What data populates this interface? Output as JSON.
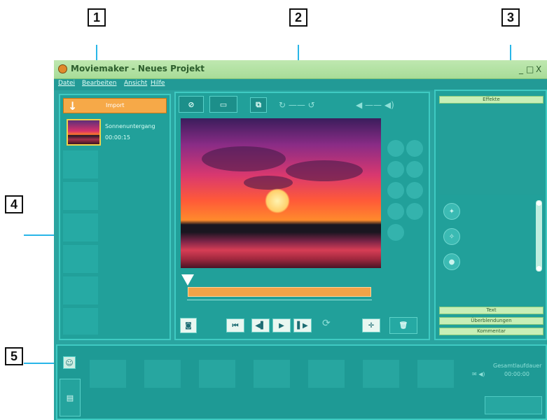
{
  "callouts": {
    "c1": "1",
    "c2": "2",
    "c3": "3",
    "c4": "4",
    "c5": "5"
  },
  "window": {
    "title": "Moviemaker - Neues Projekt",
    "minimize": "_",
    "maximize": "□",
    "close": "X"
  },
  "menu": {
    "items": [
      "Datei",
      "Bearbeiten",
      "Ansicht",
      "Hilfe"
    ]
  },
  "library": {
    "import_label": "Import",
    "clip": {
      "name": "Sonnenuntergang",
      "duration": "00:00:15"
    }
  },
  "effects": {
    "effekte": "Effekte",
    "text": "Text",
    "uebergaenge": "Überblendungen",
    "kommentar": "Kommentar"
  },
  "timeline": {
    "gesamt_label": "Gesamtlaufdauer",
    "gesamt_value": "00:00:00"
  },
  "icons": [
    "film-add-icon",
    "camera-icon",
    "copy-icon",
    "rotate-icon",
    "volume-icon",
    "zoom-icon",
    "snapshot-icon",
    "skip-back-icon",
    "step-back-icon",
    "play-icon",
    "step-forward-icon",
    "loop-icon",
    "fit-icon",
    "delete-icon",
    "smile-icon",
    "storyboard-icon"
  ],
  "colors": {
    "accent": "#f6a948",
    "panel": "#21a09a",
    "window": "#2aa4a0",
    "callout_line": "#29b6e8",
    "titlebar": "#bfe8b0"
  }
}
